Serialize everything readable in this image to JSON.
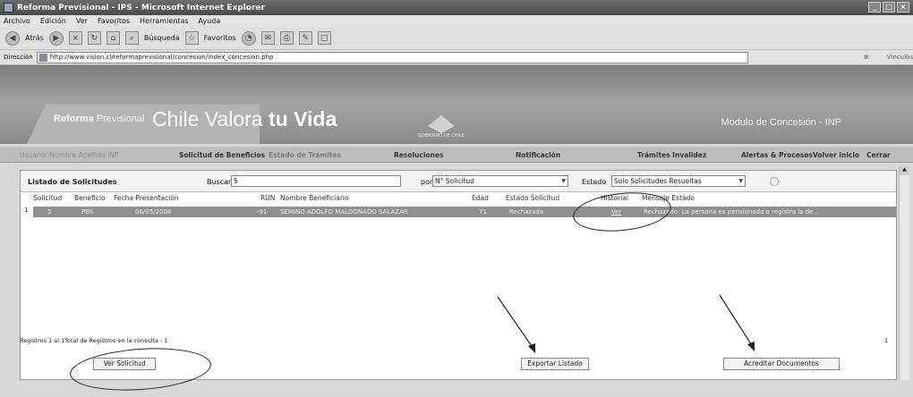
{
  "window": {
    "title": "Reforma Previsional - IPS - Microsoft Internet Explorer"
  },
  "menu": [
    "Archivo",
    "Edición",
    "Ver",
    "Favoritos",
    "Herramientas",
    "Ayuda"
  ],
  "toolbar": {
    "back_label": "Atrás",
    "search_label": "Búsqueda",
    "favorites_label": "Favoritos"
  },
  "address": {
    "label": "Dirección",
    "url": "http://www.vision.cl/reformaprevisional/concesion/index_concesion.php",
    "go_label": "Ir",
    "links_label": "Vínculos"
  },
  "banner": {
    "brand_bold": "Reforma",
    "brand_normal": "Previsional",
    "tagline_plain": "Chile Valora",
    "tagline_bold": "tu Vida",
    "emblem_text": "GOBIERNO DE CHILE",
    "module_title": "Modulo de Concesión - INP"
  },
  "nav": {
    "user": "Usuario: Nombre Apellido INP",
    "items": [
      "Solicitud de Beneficios",
      "Estado de Trámites",
      "Resoluciones",
      "Notificación",
      "Trámites Invalidez",
      "Alertas & Procesos",
      "Volver inicio",
      "Cerrar"
    ]
  },
  "filter": {
    "title": "Listado de Solicitudes",
    "search_label": "Buscar",
    "search_value": "5",
    "by_label": "por",
    "by_value": "N° Solicitud",
    "state_label": "Estado",
    "state_value": "Solo Solicitudes Resueltas"
  },
  "table": {
    "columns": [
      "Solicitud",
      "Beneficio",
      "Fecha Presentación",
      "RUN",
      "Nombre Beneficiario",
      "Edad",
      "Estado Solicitud",
      "Historial",
      "Mensaje Estado"
    ],
    "rows": [
      {
        "n": "1",
        "solicitud": "5",
        "beneficio": "PBS",
        "fecha": "06/05/2008",
        "run": "-91",
        "nombre": "SEMINO ADOLFO MALDONADO SALAZAR",
        "edad": "71",
        "estado": "Rechazada",
        "historial": "Ver",
        "mensaje": "Rechazado: La persona es pensionada o registra la de..."
      }
    ]
  },
  "footer": {
    "records": "Registros 1 al 1",
    "total": "Total de Registros en la consulta : 1",
    "page": "1"
  },
  "buttons": {
    "view": "Ver Solicitud",
    "export": "Exportar Listado",
    "accredit": "Acreditar Documentos"
  },
  "colors": {
    "banner": "#8e8e8e",
    "selected_row": "#8f8f8f",
    "annotation": "#222222"
  }
}
